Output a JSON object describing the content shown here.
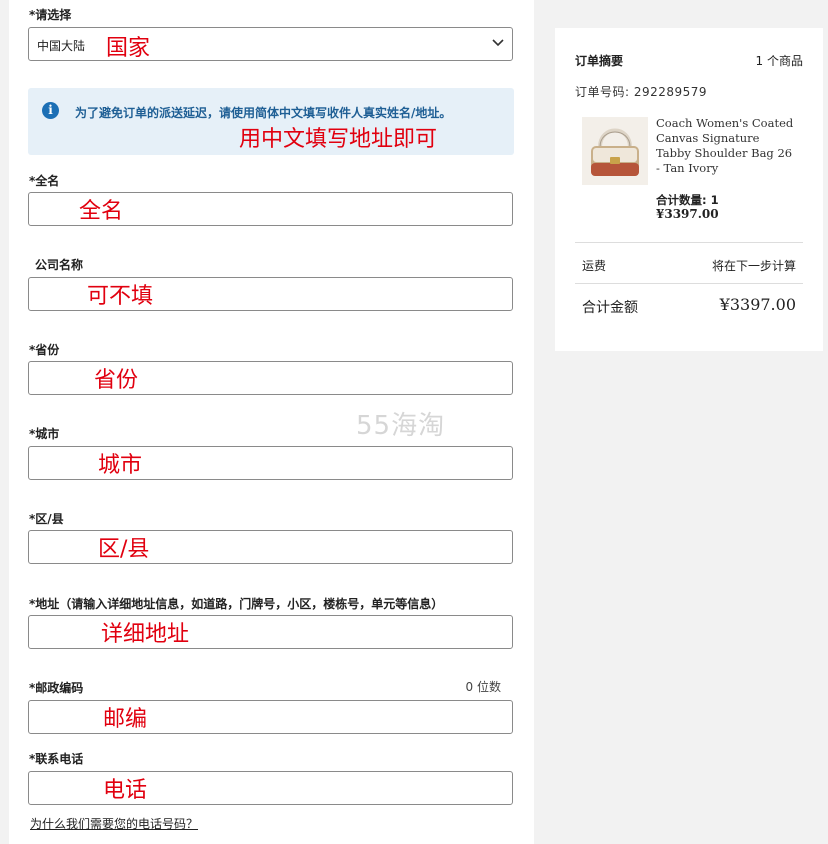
{
  "form": {
    "country": {
      "label": "*请选择",
      "value": "中国大陆",
      "note": "国家"
    },
    "info": {
      "icon": "info-icon",
      "text": "为了避免订单的派送延迟，请使用简体中文填写收件人真实姓名/地址。",
      "note": "用中文填写地址即可"
    },
    "fields": {
      "fullname": {
        "label": "*全名",
        "note": "全名"
      },
      "company": {
        "label": "公司名称",
        "note": "可不填"
      },
      "province": {
        "label": "*省份",
        "note": "省份"
      },
      "city": {
        "label": "*城市",
        "note": "城市"
      },
      "district": {
        "label": "*区/县",
        "note": "区/县"
      },
      "address": {
        "label": "*地址（请输入详细地址信息，如道路，门牌号，小区，楼栋号，单元等信息）",
        "note": "详细地址"
      },
      "postcode": {
        "label": "*邮政编码",
        "note": "邮编",
        "counter": "0 位数"
      },
      "phone": {
        "label": "*联系电话",
        "note": "电话"
      }
    },
    "help_link": "为什么我们需要您的电话号码？"
  },
  "watermark": "55海淘",
  "summary": {
    "title": "订单摘要",
    "item_count": "1 个商品",
    "order_number": "订单号码: 292289579",
    "product": {
      "name": "Coach Women's Coated Canvas Signature Tabby Shoulder Bag 26 - Tan Ivory",
      "quantity": "合计数量: 1",
      "price": "¥3397.00"
    },
    "shipping_label": "运费",
    "shipping_value": "将在下一步计算",
    "total_label": "合计金额",
    "total_value": "¥3397.00"
  },
  "colors": {
    "annotation": "#e1000f",
    "info_bg": "#e6f0f8",
    "info_icon": "#1c6fb5"
  }
}
